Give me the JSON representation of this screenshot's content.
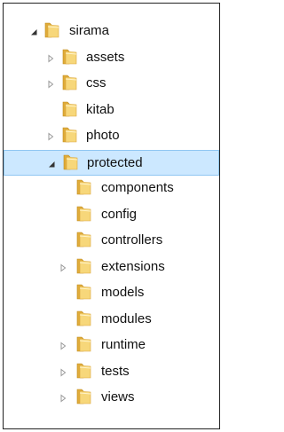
{
  "tree": {
    "items": [
      {
        "label": "sirama",
        "level": 0,
        "state": "expanded"
      },
      {
        "label": "assets",
        "level": 1,
        "state": "collapsed"
      },
      {
        "label": "css",
        "level": 1,
        "state": "collapsed"
      },
      {
        "label": "kitab",
        "level": 1,
        "state": "leaf"
      },
      {
        "label": "photo",
        "level": 1,
        "state": "collapsed"
      },
      {
        "label": "protected",
        "level": 1,
        "state": "expanded",
        "selected": true
      },
      {
        "label": "components",
        "level": 2,
        "state": "leaf"
      },
      {
        "label": "config",
        "level": 2,
        "state": "leaf"
      },
      {
        "label": "controllers",
        "level": 2,
        "state": "leaf"
      },
      {
        "label": "extensions",
        "level": 2,
        "state": "collapsed"
      },
      {
        "label": "models",
        "level": 2,
        "state": "leaf"
      },
      {
        "label": "modules",
        "level": 2,
        "state": "leaf"
      },
      {
        "label": "runtime",
        "level": 2,
        "state": "collapsed"
      },
      {
        "label": "tests",
        "level": 2,
        "state": "collapsed"
      },
      {
        "label": "views",
        "level": 2,
        "state": "collapsed"
      }
    ]
  },
  "colors": {
    "selection_bg": "#cce8ff",
    "selection_border": "#8fc6f2",
    "folder_light": "#f7d77a",
    "folder_dark": "#e0ac3a"
  },
  "icons": {
    "expanded": "triangle-expanded-icon",
    "collapsed": "triangle-collapsed-icon",
    "folder": "folder-icon"
  }
}
